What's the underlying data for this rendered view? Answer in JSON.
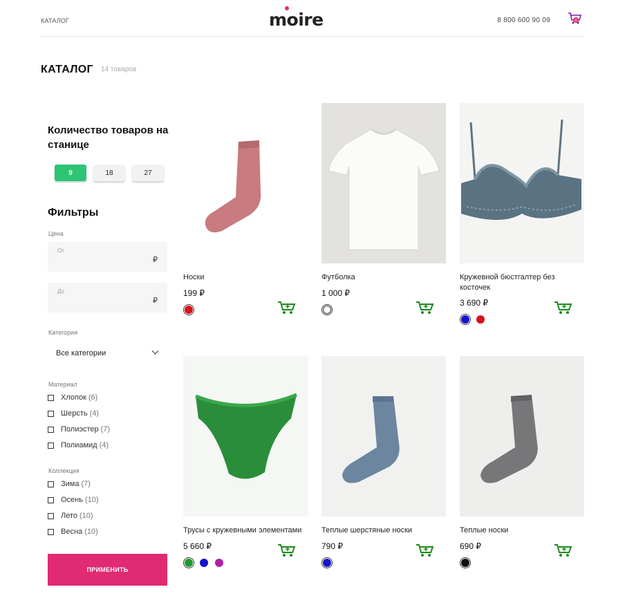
{
  "header": {
    "nav_label": "КАТАЛОГ",
    "logo": "moire",
    "phone": "8 800 600 90 09",
    "cart_count": "0"
  },
  "catalog": {
    "title": "КАТАЛОГ",
    "count": "14 товаров"
  },
  "sidebar": {
    "per_page_title": "Количество товаров на станице",
    "per_page_options": [
      "9",
      "18",
      "27"
    ],
    "per_page_selected": "9",
    "filters_title": "Фильтры",
    "price_label": "Цена",
    "price_from_placeholder": "От",
    "price_to_placeholder": "До",
    "currency": "₽",
    "category_label": "Категория",
    "category_value": "Все категории",
    "material_label": "Материал",
    "materials": [
      {
        "name": "Хлопок",
        "count": "(6)"
      },
      {
        "name": "Шерсть",
        "count": "(4)"
      },
      {
        "name": "Полиэстер",
        "count": "(7)"
      },
      {
        "name": "Полиамид",
        "count": "(4)"
      }
    ],
    "collection_label": "Коллекция",
    "collections": [
      {
        "name": "Зима",
        "count": "(7)"
      },
      {
        "name": "Осень",
        "count": "(10)"
      },
      {
        "name": "Лето",
        "count": "(10)"
      },
      {
        "name": "Весна",
        "count": "(10)"
      }
    ],
    "apply_label": "ПРИМЕНИТЬ"
  },
  "products": [
    {
      "name": "Носки",
      "price": "199 ₽",
      "image": "pink-sock",
      "colors": [
        "#d8121b"
      ],
      "selected_color": 0
    },
    {
      "name": "Футболка",
      "price": "1 000 ₽",
      "image": "white-tshirt",
      "colors": [
        "#ffffff"
      ],
      "selected_color": 0
    },
    {
      "name": "Кружевной бюстгалтер без косточек",
      "price": "3 690 ₽",
      "image": "lace-bra",
      "colors": [
        "#1414cc",
        "#d8121b"
      ],
      "selected_color": 0
    },
    {
      "name": "Трусы с кружевными элементами",
      "price": "5 660 ₽",
      "image": "green-briefs",
      "colors": [
        "#1e9b30",
        "#1414cc",
        "#b41fa8"
      ],
      "selected_color": 0
    },
    {
      "name": "Теплые шерстяные носки",
      "price": "790 ₽",
      "image": "blue-sock",
      "colors": [
        "#1414cc"
      ],
      "selected_color": 0
    },
    {
      "name": "Теплые носки",
      "price": "690 ₽",
      "image": "grey-sock",
      "colors": [
        "#111111"
      ],
      "selected_color": 0
    }
  ],
  "colors": {
    "accent_green": "#2cc574",
    "apply_pink": "#e02a72",
    "cart_icon_green": "#1a8a1a",
    "header_cart_purple": "#7a1fa0"
  }
}
